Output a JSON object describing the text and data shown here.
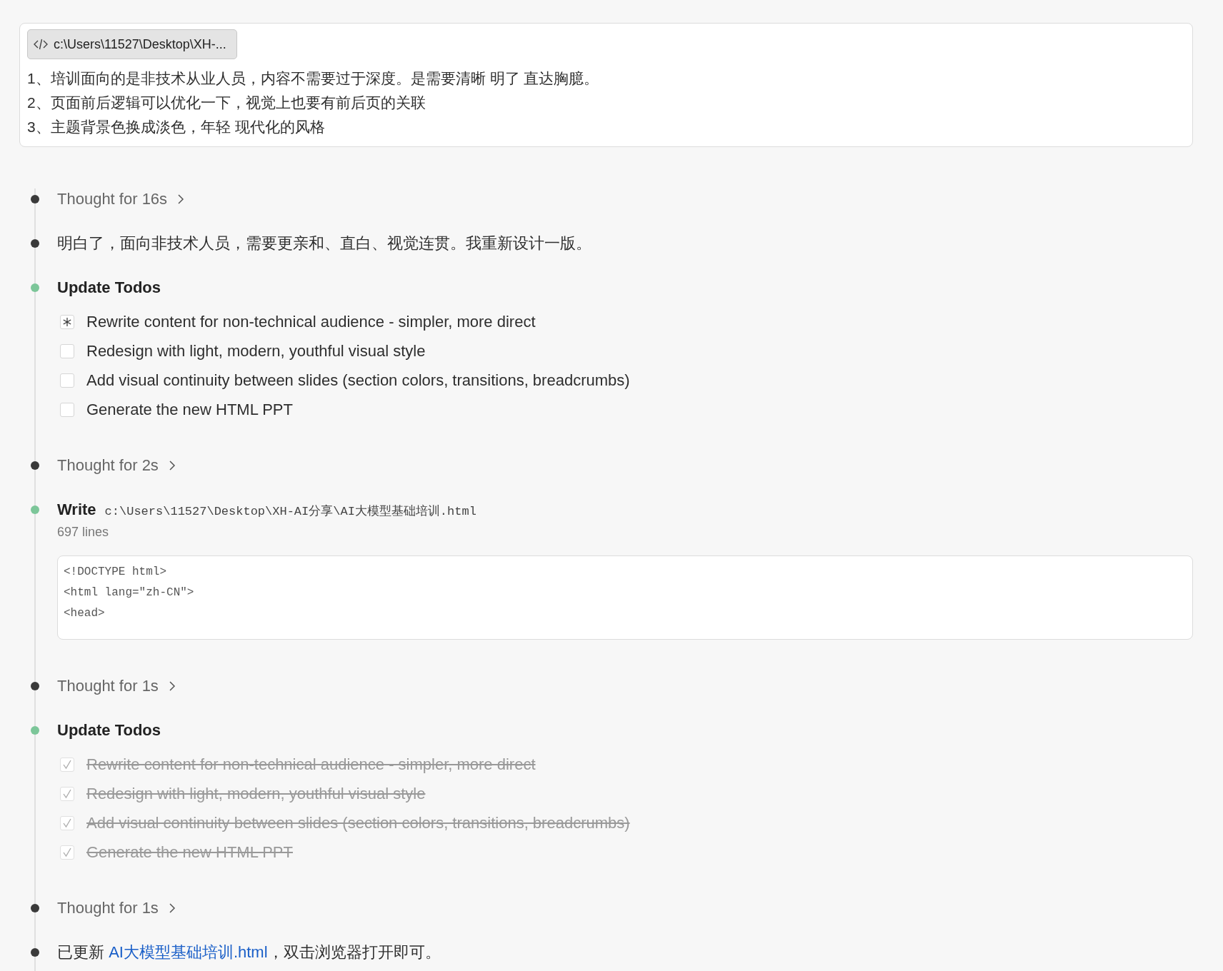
{
  "prompt": {
    "file_chip": "c:\\Users\\11527\\Desktop\\XH-...",
    "lines": [
      "1、培训面向的是非技术从业人员，内容不需要过于深度。是需要清晰 明了 直达胸臆。",
      "2、页面前后逻辑可以优化一下，视觉上也要有前后页的关联",
      "3、主题背景色换成淡色，年轻 现代化的风格"
    ]
  },
  "timeline": [
    {
      "kind": "thought",
      "color": "#3a3a3a",
      "label": "Thought for 16s"
    },
    {
      "kind": "message",
      "color": "#3a3a3a",
      "text": "明白了，面向非技术人员，需要更亲和、直白、视觉连贯。我重新设计一版。"
    },
    {
      "kind": "todos",
      "color": "#7cc699",
      "title": "Update Todos",
      "todos": [
        {
          "kind": "active",
          "label": "Rewrite content for non-technical audience - simpler, more direct",
          "checked": false
        },
        {
          "kind": "checkbox",
          "label": "Redesign with light, modern, youthful visual style",
          "checked": false
        },
        {
          "kind": "checkbox",
          "label": "Add visual continuity between slides (section colors, transitions, breadcrumbs)",
          "checked": false
        },
        {
          "kind": "checkbox",
          "label": "Generate the new HTML PPT",
          "checked": false
        }
      ]
    },
    {
      "kind": "thought",
      "color": "#3a3a3a",
      "label": "Thought for 2s"
    },
    {
      "kind": "write",
      "color": "#7cc699",
      "title": "Write",
      "path": "c:\\Users\\11527\\Desktop\\XH-AI分享\\AI大模型基础培训.html",
      "meta": "697 lines",
      "code": [
        "<!DOCTYPE html>",
        "<html lang=\"zh-CN\">",
        "<head>"
      ]
    },
    {
      "kind": "thought",
      "color": "#3a3a3a",
      "label": "Thought for 1s"
    },
    {
      "kind": "todos",
      "color": "#7cc699",
      "title": "Update Todos",
      "todos": [
        {
          "kind": "checkbox",
          "label": "Rewrite content for non-technical audience - simpler, more direct",
          "checked": true
        },
        {
          "kind": "checkbox",
          "label": "Redesign with light, modern, youthful visual style",
          "checked": true
        },
        {
          "kind": "checkbox",
          "label": "Add visual continuity between slides (section colors, transitions, breadcrumbs)",
          "checked": true
        },
        {
          "kind": "checkbox",
          "label": "Generate the new HTML PPT",
          "checked": true
        }
      ]
    },
    {
      "kind": "thought",
      "color": "#3a3a3a",
      "label": "Thought for 1s"
    },
    {
      "kind": "link_message",
      "color": "#3a3a3a",
      "before": "已更新 ",
      "link": "AI大模型基础培训.html",
      "after": "，双击浏览器打开即可。"
    }
  ]
}
